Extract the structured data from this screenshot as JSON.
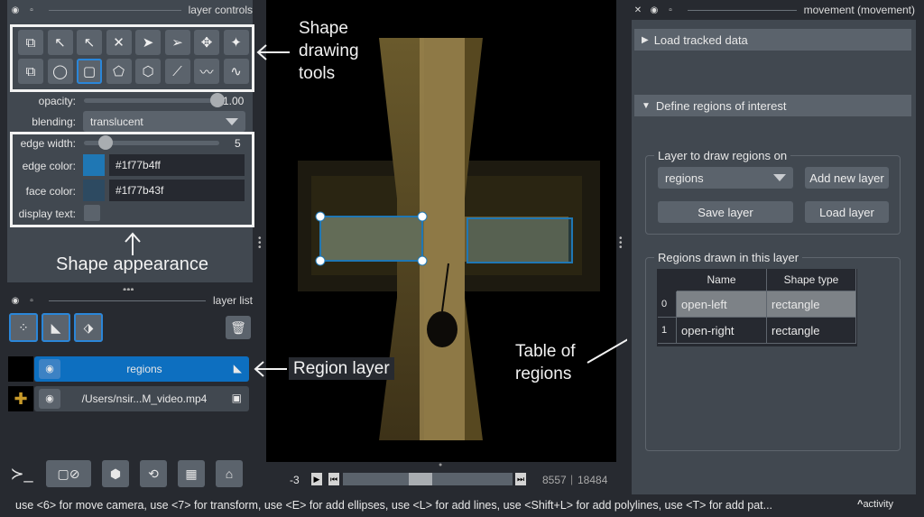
{
  "left_panel": {
    "header": {
      "title": "layer controls",
      "eye_icon": "◉",
      "float_icon": "▫"
    },
    "tools_row1": [
      {
        "name": "shape-select-icon",
        "glyph": "⧉"
      },
      {
        "name": "insert-vertex-minus-icon",
        "glyph": "↖"
      },
      {
        "name": "insert-vertex-icon",
        "glyph": "↖"
      },
      {
        "name": "delete-shape-icon",
        "glyph": "✕"
      },
      {
        "name": "select-arrow-icon",
        "glyph": "➤"
      },
      {
        "name": "direct-select-icon",
        "glyph": "➢"
      },
      {
        "name": "pan-zoom-icon",
        "glyph": "✥"
      },
      {
        "name": "transform-icon",
        "glyph": "✦"
      }
    ],
    "tools_row2": [
      {
        "name": "move-back-icon",
        "glyph": "⧉"
      },
      {
        "name": "ellipse-icon",
        "glyph": "◯"
      },
      {
        "name": "rectangle-icon",
        "glyph": "▢"
      },
      {
        "name": "polygon-icon",
        "glyph": "⬠"
      },
      {
        "name": "polygon-lasso-icon",
        "glyph": "⬡"
      },
      {
        "name": "line-icon",
        "glyph": "⟋"
      },
      {
        "name": "polyline-icon",
        "glyph": "〰"
      },
      {
        "name": "path-icon",
        "glyph": "∿"
      }
    ],
    "opacity_label": "opacity:",
    "opacity_value": "1.00",
    "opacity_level": 1.0,
    "blending_label": "blending:",
    "blending_value": "translucent",
    "edge_width_label": "edge width:",
    "edge_width_value": "5",
    "edge_width_level": 0.16,
    "edge_color_label": "edge color:",
    "edge_color_value": "#1f77b4ff",
    "edge_color_swatch": "#1f77b4",
    "face_color_label": "face color:",
    "face_color_value": "#1f77b43f",
    "face_color_swatch": "#2d4a61",
    "display_text_label": "display text:",
    "layer_list_title": "layer list",
    "layers": [
      {
        "name": "regions",
        "selected": true,
        "type_icon": "◣"
      },
      {
        "name": "/Users/nsir...M_video.mp4",
        "selected": false,
        "type_icon": "▣"
      }
    ]
  },
  "annotations": {
    "shape_tools": "Shape\ndrawing\ntools",
    "appearance": "Shape appearance",
    "region_layer": "Region layer",
    "table": "Table of\nregions"
  },
  "viewer": {
    "frame_start": "-3",
    "current_frame": "8557",
    "total_frames": "18484",
    "scroll_level": 0.45
  },
  "right_panel": {
    "header": {
      "title": "movement (movement)",
      "close_icon": "✕",
      "eye_icon": "◉",
      "float_icon": "▫"
    },
    "load_section": "Load tracked data",
    "define_section": "Define regions of interest",
    "layer_group_title": "Layer to draw regions on",
    "layer_select": "regions",
    "add_layer_btn": "Add new layer",
    "save_layer_btn": "Save layer",
    "load_layer_btn": "Load layer",
    "table_group_title": "Regions drawn in this layer",
    "table": {
      "headers": [
        "Name",
        "Shape type"
      ],
      "rows": [
        {
          "idx": "0",
          "name": "open-left",
          "type": "rectangle",
          "selected": true
        },
        {
          "idx": "1",
          "name": "open-right",
          "type": "rectangle",
          "selected": false
        }
      ]
    }
  },
  "status_bar": {
    "text": "use <6> for move camera, use <7> for transform, use <E> for add ellipses, use <L> for add lines, use <Shift+L> for add polylines, use <T> for add pat...",
    "activity": "activity"
  }
}
